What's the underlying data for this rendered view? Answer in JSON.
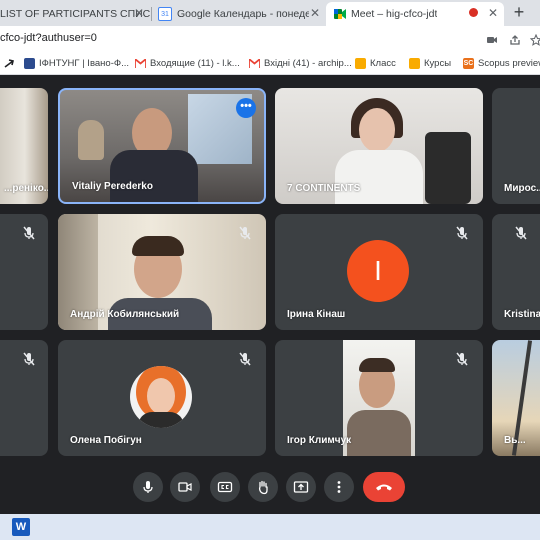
{
  "browser": {
    "tabs": [
      {
        "label": "LIST OF PARTICIPANTS СПИСОК",
        "active": false
      },
      {
        "label": "Google Календарь - понедельник",
        "active": false
      },
      {
        "label": "Meet – hig-cfco-jdt",
        "active": true
      }
    ],
    "calendar_favicon_text": "31",
    "url": "cfco-jdt?authuser=0",
    "new_tab_label": "+"
  },
  "bookmarks": [
    {
      "label": "",
      "icon": "arrow-icon"
    },
    {
      "label": "ІФНТУНГ | Івано-Ф...",
      "icon": "crest-icon"
    },
    {
      "label": "Входящие (11) - l.k...",
      "icon": "gmail-icon"
    },
    {
      "label": "Вхідні (41) - archip...",
      "icon": "gmail-icon"
    },
    {
      "label": "Класс",
      "icon": "classroom-icon"
    },
    {
      "label": "Курсы",
      "icon": "classroom-icon"
    },
    {
      "label": "Scopus preview",
      "icon": "scopus-icon"
    }
  ],
  "participants": {
    "p1": {
      "name": "...реніко..."
    },
    "p2": {
      "name": "Vitaliy Perederko"
    },
    "p3": {
      "name": "7 CONTINENTS"
    },
    "p4": {
      "name": "Мирос..."
    },
    "p5": {
      "name": ""
    },
    "p6": {
      "name": "Андрій Кобилянський"
    },
    "p7": {
      "name": "Ірина Кінаш",
      "avatar_letter": "I"
    },
    "p8": {
      "name": "Kristina..."
    },
    "p9": {
      "name": ""
    },
    "p10": {
      "name": "Олена Побігун"
    },
    "p11": {
      "name": "Ігор Климчук"
    },
    "p12": {
      "name": "Вь..."
    }
  },
  "more_options_label": "•••",
  "scopus_icon_text": "SC",
  "taskbar": {
    "word_icon": "W"
  },
  "colors": {
    "meet_bg": "#202124",
    "tile_bg": "#3c4043",
    "hangup": "#ea4335",
    "avatar_orange": "#f4511e",
    "pin_border": "#8ab4f8"
  }
}
